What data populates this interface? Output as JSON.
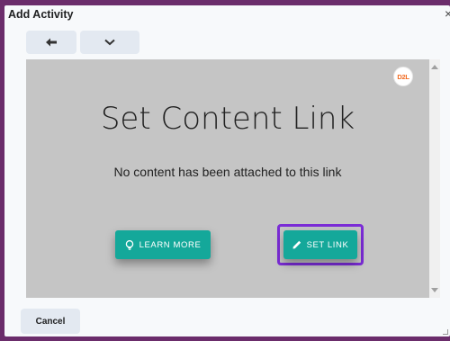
{
  "dialog": {
    "title": "Add Activity",
    "close_label": "×"
  },
  "toolbar": {
    "back_icon": "arrow-left-icon",
    "more_icon": "chevron-down-icon"
  },
  "content": {
    "badge_text": "D2L",
    "heading": "Set Content Link",
    "message": "No content has been attached to this link",
    "learn_more_label": "LEARN MORE",
    "learn_more_icon": "lightbulb-icon",
    "set_link_label": "SET LINK",
    "set_link_icon": "pencil-icon"
  },
  "footer": {
    "cancel_label": "Cancel"
  },
  "colors": {
    "accent_teal": "#14a89a",
    "focus_outline": "#7b2cd6",
    "frame_bg": "#c5c5c5",
    "page_bg": "#6b2d6b"
  }
}
